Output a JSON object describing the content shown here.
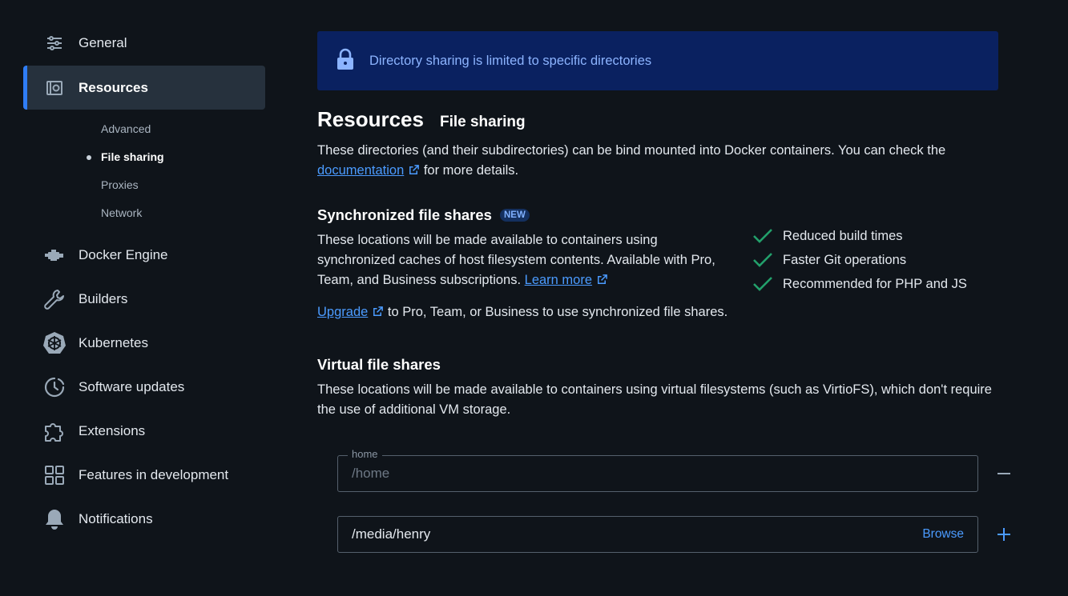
{
  "sidebar": {
    "items": [
      {
        "label": "General",
        "icon": "sliders-icon"
      },
      {
        "label": "Resources",
        "icon": "resources-icon"
      },
      {
        "label": "Docker Engine",
        "icon": "engine-icon"
      },
      {
        "label": "Builders",
        "icon": "wrench-icon"
      },
      {
        "label": "Kubernetes",
        "icon": "kubernetes-icon"
      },
      {
        "label": "Software updates",
        "icon": "clock-update-icon"
      },
      {
        "label": "Extensions",
        "icon": "puzzle-icon"
      },
      {
        "label": "Features in development",
        "icon": "grid-icon"
      },
      {
        "label": "Notifications",
        "icon": "bell-icon"
      }
    ],
    "resources_sub": [
      "Advanced",
      "File sharing",
      "Proxies",
      "Network"
    ]
  },
  "banner": {
    "text": "Directory sharing is limited to specific directories",
    "icon": "lock-icon"
  },
  "header": {
    "title": "Resources",
    "subtitle": "File sharing"
  },
  "intro": {
    "text_before": "These directories (and their subdirectories) can be bind mounted into Docker containers. You can check the",
    "link": "documentation",
    "text_after": "for more details."
  },
  "sync": {
    "title": "Synchronized file shares",
    "badge": "NEW",
    "description": "These locations will be made available to containers using synchronized caches of host filesystem contents. Available with Pro, Team, and Business subscriptions.",
    "learn_more": "Learn more",
    "benefits": [
      "Reduced build times",
      "Faster Git operations",
      "Recommended for PHP and JS"
    ],
    "upgrade_link": "Upgrade",
    "upgrade_text": "to Pro, Team, or Business to use synchronized file shares."
  },
  "virtual": {
    "title": "Virtual file shares",
    "description": "These locations will be made available to containers using virtual filesystems (such as VirtioFS), which don't require the use of additional VM storage.",
    "shares": [
      {
        "legend": "home",
        "value": "/home"
      }
    ],
    "new_share": {
      "value": "/media/henry",
      "browse": "Browse"
    }
  },
  "colors": {
    "accent": "#2f7df5",
    "link": "#4b9bff",
    "check": "#22a06b",
    "banner_bg": "#0a2160"
  }
}
